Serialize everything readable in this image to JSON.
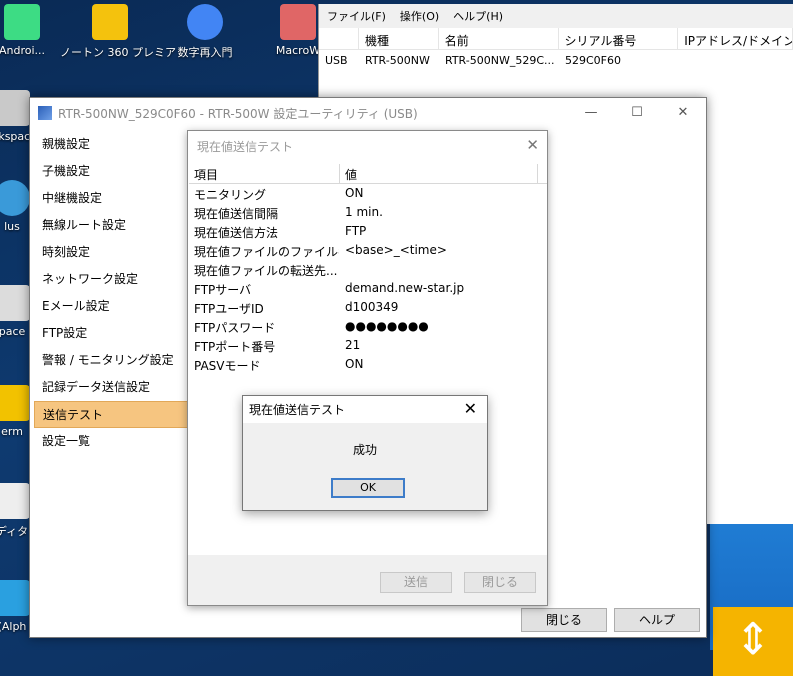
{
  "desktop": {
    "icons": [
      {
        "label": "Androi...",
        "name": "android-icon",
        "color": "#3ddc84"
      },
      {
        "label": "ノートン 360 プレミア",
        "name": "norton-icon",
        "color": "#f4c20d"
      },
      {
        "label": "数字再入門",
        "name": "chrome-icon",
        "color": "#4285f4"
      },
      {
        "label": "MacroW",
        "name": "macro-icon",
        "color": "#e06666"
      },
      {
        "label": "rkspac",
        "name": "workspace-icon",
        "color": "#c9c9c9"
      },
      {
        "label": "lus",
        "name": "plus-app-icon",
        "color": "#3a9ad9"
      },
      {
        "label": "pace",
        "name": "space-app-icon",
        "color": "#dcdcdc"
      },
      {
        "label": "erm",
        "name": "terminal-icon",
        "color": "#f2c200"
      },
      {
        "label": "ディタ",
        "name": "editor-icon",
        "color": "#eeeeee"
      },
      {
        "label": "(Alph",
        "name": "alpha-app-icon",
        "color": "#2aa0e0"
      }
    ],
    "accent_tile_color": "#f5b400"
  },
  "bg_window": {
    "menu": [
      "ファイル(F)",
      "操作(O)",
      "ヘルプ(H)"
    ],
    "columns": [
      "機種",
      "名前",
      "シリアル番号",
      "IPアドレス/ドメイン"
    ],
    "row": {
      "type": "USB",
      "model": "RTR-500NW",
      "name": "RTR-500NW_529C...",
      "serial": "529C0F60"
    }
  },
  "main_window": {
    "title": "RTR-500NW_529C0F60 - RTR-500W 設定ユーティリティ (USB)",
    "nav": [
      "親機設定",
      "子機設定",
      "中継機設定",
      "無線ルート設定",
      "時刻設定",
      "ネットワーク設定",
      "Eメール設定",
      "FTP設定",
      "警報 / モニタリング設定",
      "記録データ送信設定",
      "送信テスト",
      "設定一覧"
    ],
    "active_index": 10,
    "close_label": "閉じる",
    "help_label": "ヘルプ",
    "active_color": "#f6c580"
  },
  "test_dialog": {
    "title": "現在値送信テスト",
    "headers": [
      "項目",
      "値"
    ],
    "rows": [
      {
        "k": "モニタリング",
        "v": "ON"
      },
      {
        "k": "現在値送信間隔",
        "v": "1 min."
      },
      {
        "k": "現在値送信方法",
        "v": "FTP"
      },
      {
        "k": "現在値ファイルのファイル名",
        "v": "<base>_<time>"
      },
      {
        "k": "現在値ファイルの転送先...",
        "v": ""
      },
      {
        "k": "FTPサーバ",
        "v": "demand.new-star.jp"
      },
      {
        "k": "FTPユーザID",
        "v": "d100349"
      },
      {
        "k": "FTPパスワード",
        "v": "●●●●●●●●"
      },
      {
        "k": "FTPポート番号",
        "v": "21"
      },
      {
        "k": "PASVモード",
        "v": "ON"
      }
    ],
    "send_label": "送信",
    "close_label": "閉じる"
  },
  "popup": {
    "title": "現在値送信テスト",
    "message": "成功",
    "ok_label": "OK"
  }
}
